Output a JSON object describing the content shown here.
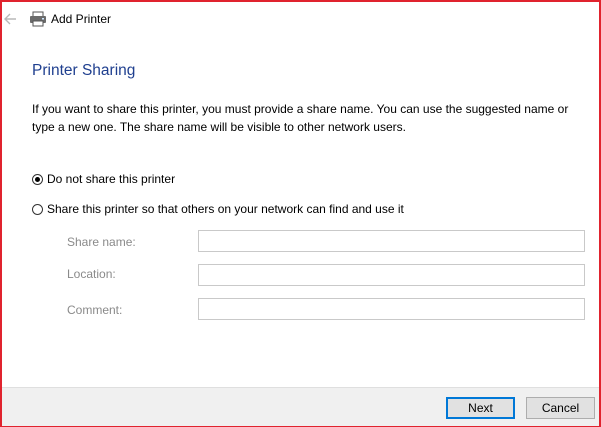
{
  "window": {
    "title": "Add Printer",
    "back_icon": "back-arrow-icon",
    "app_icon": "printer-icon",
    "border_color": "#e0232e"
  },
  "page": {
    "heading": "Printer Sharing",
    "heading_color": "#1f3f8f",
    "description": "If you want to share this printer, you must provide a share name. You can use the suggested name or type a new one. The share name will be visible to other network users."
  },
  "options": [
    {
      "label": "Do not share this printer",
      "selected": true
    },
    {
      "label": "Share this printer so that others on your network can find and use it",
      "selected": false
    }
  ],
  "fields": [
    {
      "label": "Share name:",
      "value": ""
    },
    {
      "label": "Location:",
      "value": ""
    },
    {
      "label": "Comment:",
      "value": ""
    }
  ],
  "buttons": {
    "next": "Next",
    "cancel": "Cancel"
  }
}
